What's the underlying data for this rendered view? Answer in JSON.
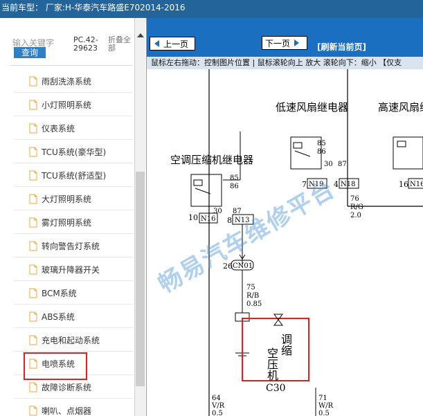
{
  "topbar": {
    "label": "当前车型：",
    "text": "厂家:H-华泰汽车路盛E702014-2016"
  },
  "sidebar": {
    "search_placeholder": "输入关键字",
    "search_button": "查询",
    "code": "PC.42-29623",
    "collapse": "折叠全部",
    "items": [
      {
        "label": "雨刮洗涤系统"
      },
      {
        "label": "小灯照明系统"
      },
      {
        "label": "仪表系统"
      },
      {
        "label": "TCU系统(豪华型)"
      },
      {
        "label": "TCU系统(舒适型)"
      },
      {
        "label": "大灯照明系统"
      },
      {
        "label": "雾灯照明系统"
      },
      {
        "label": "转向警告灯系统"
      },
      {
        "label": "玻璃升降器开关"
      },
      {
        "label": "BCM系统"
      },
      {
        "label": "ABS系统"
      },
      {
        "label": "充电和起动系统"
      },
      {
        "label": "电喷系统"
      },
      {
        "label": "故障诊断系统"
      },
      {
        "label": "喇叭、点烟器"
      }
    ]
  },
  "viewer": {
    "prev": "上一页",
    "next": "下一页",
    "refresh": "[刷新当前页]",
    "hint": "鼠标左右拖动：控制图片位置 | 鼠标滚轮向上 放大  滚轮向下：缩小 【仅支",
    "watermark": "畅易汽车维修平台"
  },
  "diagram": {
    "relay_left": "空调压缩机继电器",
    "relay_mid": "低速风扇继电器",
    "relay_right": "高速风扇继电器",
    "pin85": "85",
    "pin86": "86",
    "pin30": "30",
    "pin87": "87",
    "pin10": "10",
    "pin8": "8",
    "pin7": "7",
    "pin4": "4",
    "pin16": "16",
    "pin26": "26",
    "conn_n16": "N16",
    "conn_n13": "N13",
    "conn_n19": "N19",
    "conn_n18": "N18",
    "conn_n16b": "N16",
    "conn_cn01": "CN01",
    "w75": "75",
    "w75c": "R/B",
    "w75s": "0.85",
    "w76": "76",
    "w76c": "R/G",
    "w76s": "2.0",
    "w64": "64",
    "w64c": "V/R",
    "w64s": "0.5",
    "w71": "71",
    "w71c": "W/R",
    "w71s": "0.5",
    "comp_label1": "空",
    "comp_label2": "调",
    "comp_label3": "压",
    "comp_label4": "缩",
    "comp_label5": "机",
    "comp_code": "C30"
  }
}
